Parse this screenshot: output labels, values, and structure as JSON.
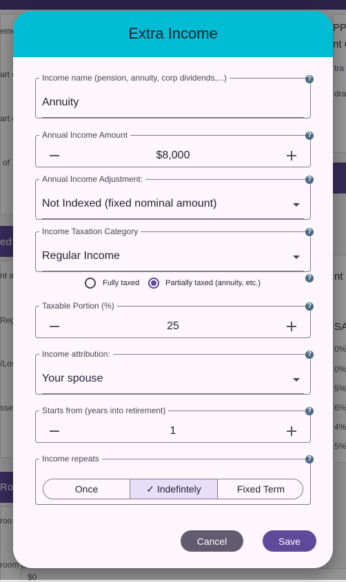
{
  "background": {
    "fragments": [
      "eme",
      "art c",
      "art c",
      "of",
      "ed",
      "nt a",
      "Reg",
      "/Los",
      "sses",
      "Ro",
      "roo",
      "room a",
      "$0",
      "PPA",
      "nt C",
      "tra",
      "draw",
      "nt",
      "SA",
      "0%",
      "0%",
      "5%",
      "6%",
      "4%",
      "5%"
    ]
  },
  "dialog": {
    "title": "Extra Income",
    "help_glyph": "?",
    "income_name": {
      "label": "Income name (pension, annuity, corp dividends,...)",
      "value": "Annuity"
    },
    "annual_amount": {
      "label": "Annual Income Amount",
      "value": "$8,000"
    },
    "adjustment": {
      "label": "Annual Income Adjustment:",
      "value": "Not Indexed (fixed nominal amount)"
    },
    "taxation": {
      "label": "Income Taxation Category",
      "value": "Regular Income"
    },
    "tax_radio": {
      "options": [
        "Fully taxed",
        "Partially taxed (annuity, etc.)"
      ],
      "selected": 1
    },
    "taxable_portion": {
      "label": "Taxable Portion (%)",
      "value": "25"
    },
    "attribution": {
      "label": "Income attribution:",
      "value": "Your spouse"
    },
    "starts_from": {
      "label": "Starts from (years into retirement)",
      "value": "1"
    },
    "repeats": {
      "label": "Income repeats",
      "options": [
        "Once",
        "Indefintely",
        "Fixed Term"
      ],
      "selected": 1
    },
    "cancel_label": "Cancel",
    "save_label": "Save"
  },
  "colors": {
    "header": "#00bcd4",
    "accent": "#5d4a9a",
    "cancel": "#615b6f",
    "dialog_bg": "#fdf7fd"
  }
}
